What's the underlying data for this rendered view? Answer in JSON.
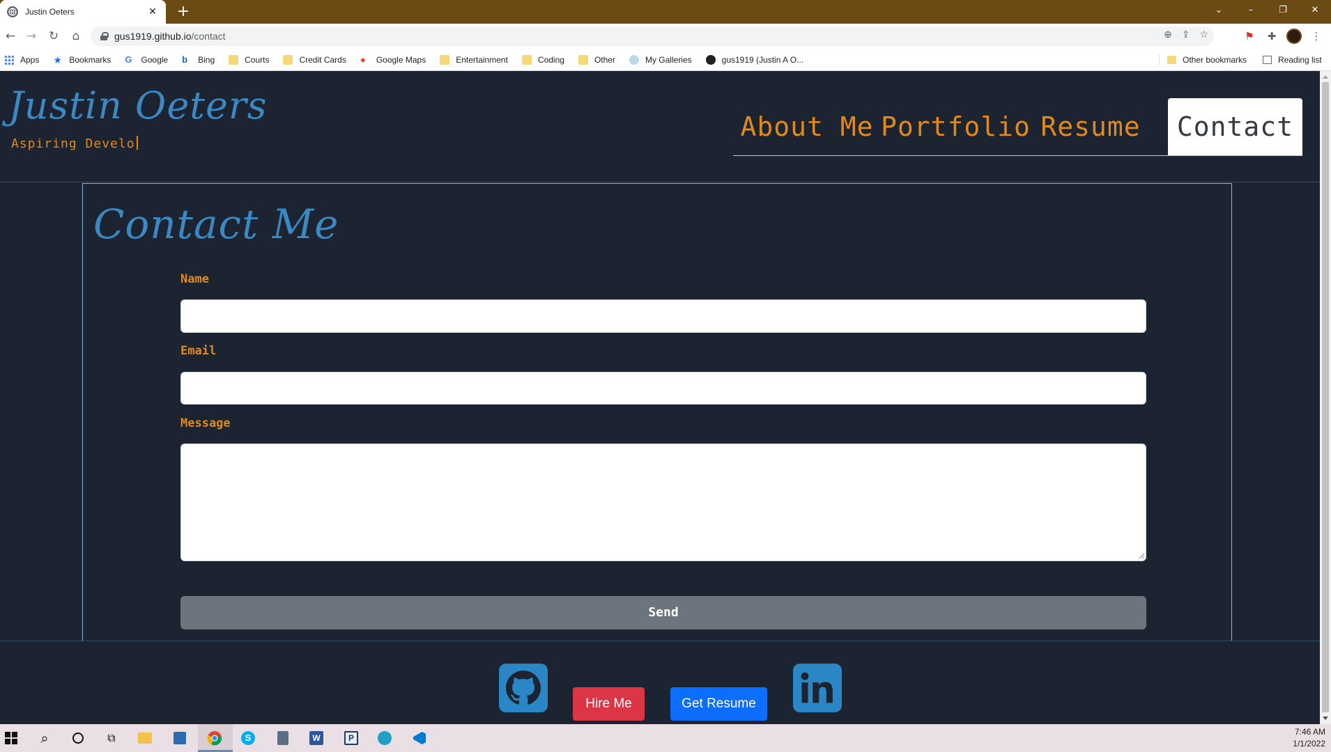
{
  "browser": {
    "tab_title": "Justin Oeters",
    "url_host": "gus1919.github.io",
    "url_path": "/contact",
    "bookmarks": [
      {
        "label": "Apps",
        "icon": "apps-grid-icon"
      },
      {
        "label": "Bookmarks",
        "icon": "star-icon"
      },
      {
        "label": "Google",
        "icon": "google-icon"
      },
      {
        "label": "Bing",
        "icon": "bing-icon"
      },
      {
        "label": "Courts",
        "icon": "folder-icon"
      },
      {
        "label": "Credit Cards",
        "icon": "folder-icon"
      },
      {
        "label": "Google Maps",
        "icon": "map-pin-icon"
      },
      {
        "label": "Entertainment",
        "icon": "folder-icon"
      },
      {
        "label": "Coding",
        "icon": "folder-icon"
      },
      {
        "label": "Other",
        "icon": "folder-icon"
      },
      {
        "label": "My Galleries",
        "icon": "gallery-icon"
      },
      {
        "label": "gus1919 (Justin A O...",
        "icon": "github-icon"
      }
    ],
    "other_bookmarks": "Other bookmarks",
    "reading_list": "Reading list"
  },
  "site": {
    "name": "Justin Oeters",
    "tagline": "Aspiring Develo",
    "nav": [
      "About Me",
      "Portfolio",
      "Resume",
      "Contact"
    ],
    "active_nav": "Contact"
  },
  "contact": {
    "title": "Contact Me",
    "name_label": "Name",
    "email_label": "Email",
    "message_label": "Message",
    "name_value": "",
    "email_value": "",
    "message_value": "",
    "send_label": "Send"
  },
  "footer": {
    "hire_label": "Hire Me",
    "resume_label": "Get Resume",
    "github_icon": "github-icon",
    "linkedin_icon": "linkedin-icon"
  },
  "taskbar": {
    "time": "7:46 AM",
    "date": "1/1/2022"
  },
  "colors": {
    "page_bg": "#1c2431",
    "accent_blue": "#3b88c3",
    "accent_orange": "#e08a1e",
    "hire_red": "#dc3545",
    "resume_blue": "#0d6efd",
    "send_gray": "#6c757d",
    "title_bar": "#6b4a14"
  }
}
